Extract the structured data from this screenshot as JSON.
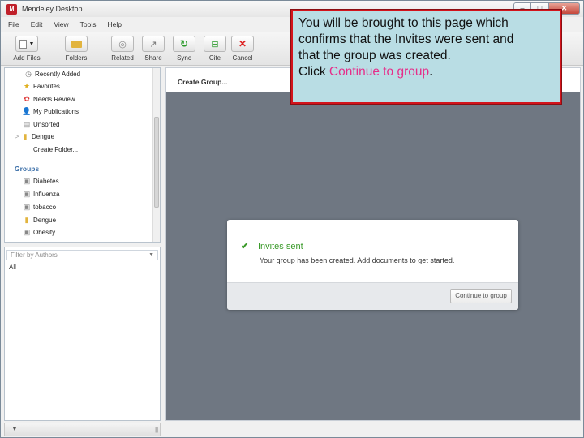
{
  "window": {
    "title": "Mendeley Desktop",
    "logo_text": "M"
  },
  "window_controls": {
    "minimize": "–",
    "maximize": "□",
    "close": "✕"
  },
  "menu": [
    "File",
    "Edit",
    "View",
    "Tools",
    "Help"
  ],
  "toolbar": [
    {
      "label": "Add Files",
      "icon": "add-files-icon"
    },
    {
      "label": "Folders",
      "icon": "folder-icon"
    },
    {
      "label": "Related",
      "icon": "related-icon"
    },
    {
      "label": "Share",
      "icon": "share-icon"
    },
    {
      "label": "Sync",
      "icon": "sync-icon"
    },
    {
      "label": "Cite",
      "icon": "cite-icon"
    },
    {
      "label": "Cancel",
      "icon": "cancel-icon"
    }
  ],
  "sidebar": {
    "items": [
      {
        "label": "Recently Added",
        "icon": "clock-icon"
      },
      {
        "label": "Favorites",
        "icon": "star-icon"
      },
      {
        "label": "Needs Review",
        "icon": "review-icon"
      },
      {
        "label": "My Publications",
        "icon": "person-icon"
      },
      {
        "label": "Unsorted",
        "icon": "document-icon"
      },
      {
        "label": "Dengue",
        "icon": "folder-icon"
      },
      {
        "label": "Create Folder...",
        "icon": ""
      }
    ],
    "groups_heading": "Groups",
    "groups": [
      {
        "label": "Diabetes",
        "icon": "group-icon"
      },
      {
        "label": "Influenza",
        "icon": "group-icon"
      },
      {
        "label": "tobacco",
        "icon": "group-icon"
      },
      {
        "label": "Dengue",
        "icon": "group-folder-icon"
      },
      {
        "label": "Obesity",
        "icon": "group-icon"
      }
    ]
  },
  "filter": {
    "selected": "Filter by Authors",
    "all_label": "All"
  },
  "main": {
    "title": "Create Group..."
  },
  "dialog": {
    "heading": "Invites sent",
    "message": "Your group has been created. Add documents to get started.",
    "button": "Continue to group"
  },
  "callout": {
    "line1": "You will be brought to this page which",
    "line2": "confirms that the Invites were sent and",
    "line3": "that the group was created.",
    "line4_prefix": "Click ",
    "line4_highlight": "Continue to group",
    "line4_suffix": "."
  },
  "colors": {
    "accent_green": "#3a9a2a",
    "callout_bg": "#b9dde4",
    "callout_border": "#d3141c",
    "highlight": "#e62e8a",
    "app_red": "#c0202a"
  }
}
